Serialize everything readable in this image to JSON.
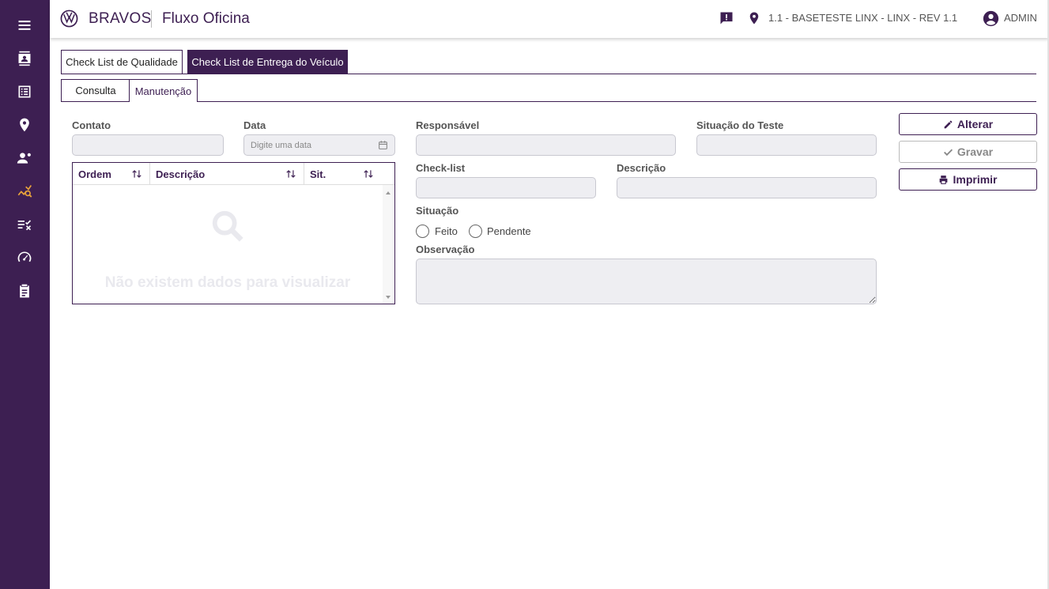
{
  "sidebar": {
    "items": [
      {
        "name": "menu-icon"
      },
      {
        "name": "contacts-icon"
      },
      {
        "name": "list-icon"
      },
      {
        "name": "location-icon"
      },
      {
        "name": "user-settings-icon"
      },
      {
        "name": "analytics-icon"
      },
      {
        "name": "checklist-icon"
      },
      {
        "name": "speedometer-icon"
      },
      {
        "name": "clipboard-icon"
      }
    ],
    "active_color": "#e8a33b",
    "bg_color": "#3d1f52"
  },
  "header": {
    "brand": "BRAVOS",
    "module": "Fluxo Oficina",
    "branch": "1.1 - BASETESTE LINX - LINX - REV 1.1",
    "user": "ADMIN"
  },
  "tabs_main": [
    {
      "label": "Check List de Qualidade",
      "active": false
    },
    {
      "label": "Check List de Entrega do Veículo",
      "active": true
    }
  ],
  "tabs_sub": [
    {
      "label": "Consulta",
      "active": false
    },
    {
      "label": "Manutenção",
      "active": true
    }
  ],
  "form": {
    "contato_label": "Contato",
    "data_label": "Data",
    "data_placeholder": "Digite uma data",
    "responsavel_label": "Responsável",
    "situacao_teste_label": "Situação do Teste",
    "checklist_label": "Check-list",
    "descricao_label": "Descrição",
    "situacao_label": "Situação",
    "situacao_options": [
      "Feito",
      "Pendente"
    ],
    "observacao_label": "Observação"
  },
  "grid": {
    "columns": [
      "Ordem",
      "Descrição",
      "Sit."
    ],
    "empty_text": "Não existem dados para visualizar"
  },
  "actions": {
    "alterar": "Alterar",
    "gravar": "Gravar",
    "imprimir": "Imprimir"
  }
}
